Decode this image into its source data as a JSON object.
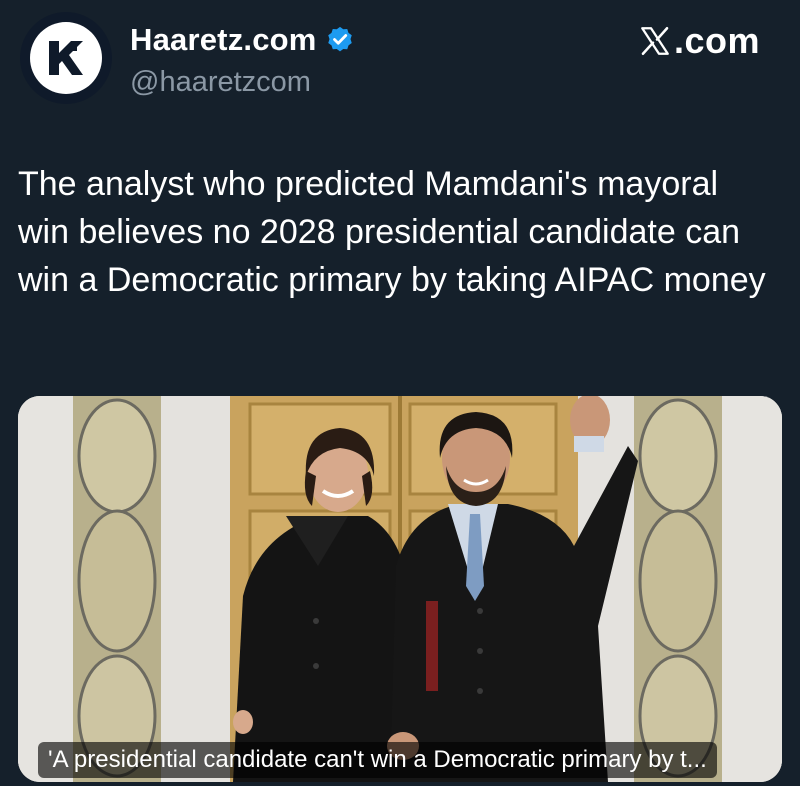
{
  "account": {
    "display_name": "Haaretz.com",
    "handle": "@haaretzcom",
    "avatar_icon": "haaretz-logo-icon",
    "verified_icon": "verified-badge-icon",
    "verified_color": "#1d9bf0"
  },
  "brand": {
    "icon": "x-logo-icon",
    "text": ".com"
  },
  "tweet": {
    "text": "The analyst who predicted Mamdani's mayoral win believes no 2028 presidential candidate can win a Democratic primary by taking AIPAC money"
  },
  "media": {
    "caption": "'A presidential candidate can't win a Democratic primary by t..."
  },
  "colors": {
    "background": "#15202b",
    "text": "#ffffff",
    "secondary_text": "#8b98a5"
  }
}
